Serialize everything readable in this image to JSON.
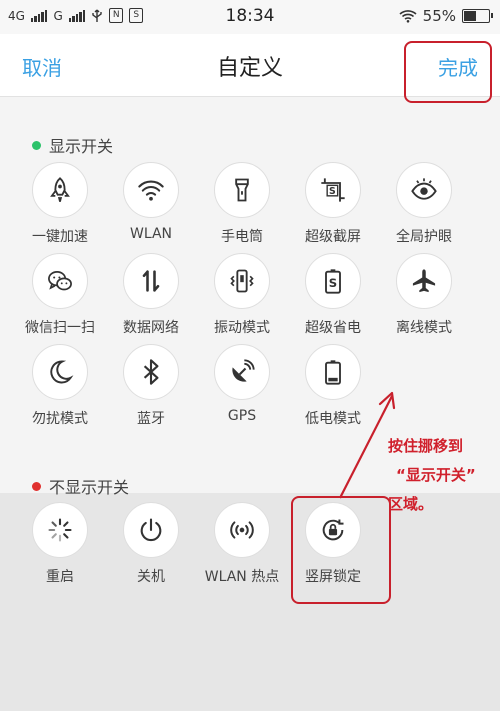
{
  "status_bar": {
    "left_network": "4G",
    "right_network": "G",
    "usb_icon": "usb-icon",
    "nfc_label": "N",
    "s_label": "S",
    "time": "18:34",
    "battery_percent": "55%",
    "battery_level": 0.55
  },
  "header": {
    "cancel": "取消",
    "title": "自定义",
    "done": "完成"
  },
  "shown_section": {
    "title": "显示开关",
    "dot_color": "#2cc26a",
    "items": [
      {
        "label": "一键加速",
        "icon": "rocket-icon"
      },
      {
        "label": "WLAN",
        "icon": "wifi-icon"
      },
      {
        "label": "手电筒",
        "icon": "flashlight-icon"
      },
      {
        "label": "超级截屏",
        "icon": "super-screenshot-icon"
      },
      {
        "label": "全局护眼",
        "icon": "eye-icon"
      },
      {
        "label": "微信扫一扫",
        "icon": "wechat-scan-icon"
      },
      {
        "label": "数据网络",
        "icon": "data-network-icon"
      },
      {
        "label": "振动模式",
        "icon": "vibrate-icon"
      },
      {
        "label": "超级省电",
        "icon": "super-power-saving-icon"
      },
      {
        "label": "离线模式",
        "icon": "airplane-icon"
      },
      {
        "label": "勿扰模式",
        "icon": "moon-icon"
      },
      {
        "label": "蓝牙",
        "icon": "bluetooth-icon"
      },
      {
        "label": "GPS",
        "icon": "gps-icon"
      },
      {
        "label": "低电模式",
        "icon": "low-battery-icon"
      }
    ]
  },
  "hidden_section": {
    "title": "不显示开关",
    "dot_color": "#e0302e",
    "items": [
      {
        "label": "重启",
        "icon": "restart-icon"
      },
      {
        "label": "关机",
        "icon": "power-icon"
      },
      {
        "label": "WLAN 热点",
        "icon": "hotspot-icon"
      },
      {
        "label": "竖屏锁定",
        "icon": "rotation-lock-icon"
      }
    ]
  },
  "annotation": {
    "line1": "按住挪移到",
    "line2": "“显示开关”",
    "line3": "区域。",
    "color": "#d0202c"
  }
}
